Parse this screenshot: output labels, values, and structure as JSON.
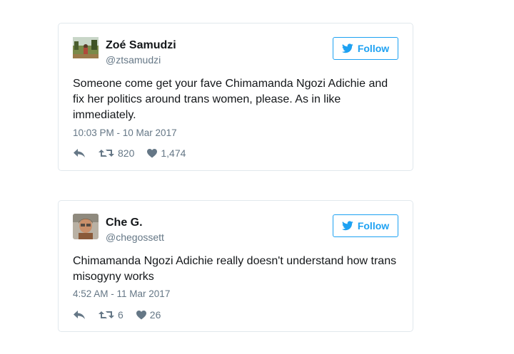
{
  "tweets": [
    {
      "name": "Zoé Samudzi",
      "handle": "@ztsamudzi",
      "follow_label": "Follow",
      "text": "Someone come get your fave Chimamanda Ngozi Adichie and fix her politics around trans women, please. As in like immediately.",
      "timestamp": "10:03 PM - 10 Mar 2017",
      "retweets": "820",
      "likes": "1,474",
      "avatar_icon": "landscape-avatar"
    },
    {
      "name": "Che G.",
      "handle": "@chegossett",
      "follow_label": "Follow",
      "text": "Chimamanda Ngozi Adichie really doesn't understand how trans misogyny works",
      "timestamp": "4:52 AM - 11 Mar 2017",
      "retweets": "6",
      "likes": "26",
      "avatar_icon": "portrait-avatar"
    }
  ],
  "colors": {
    "brand_blue": "#1da1f2",
    "muted_text": "#657786",
    "card_border": "#e1e8ed"
  }
}
